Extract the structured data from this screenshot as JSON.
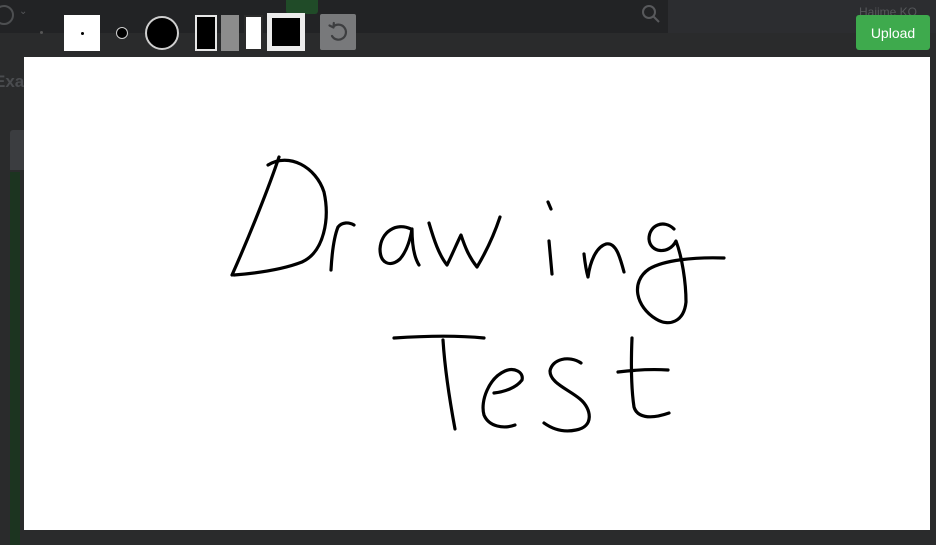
{
  "background_app": {
    "user_name": "Hajime KO",
    "page_title": "Exa"
  },
  "toolbar": {
    "pen_sizes": [
      "small",
      "medium",
      "large"
    ],
    "colors": [
      "#000000",
      "#8c8c8c",
      "#ffffff",
      "#000000"
    ],
    "selected_color": "#000000",
    "undo_icon": "undo-icon",
    "upload_label": "Upload"
  },
  "canvas": {
    "background": "#ffffff",
    "handwritten_text": [
      "Drawing",
      "Test"
    ]
  },
  "colors": {
    "upload_button": "#3eaa4d",
    "undo_button": "#78797b",
    "overlay_background": "#2a2b2c"
  }
}
